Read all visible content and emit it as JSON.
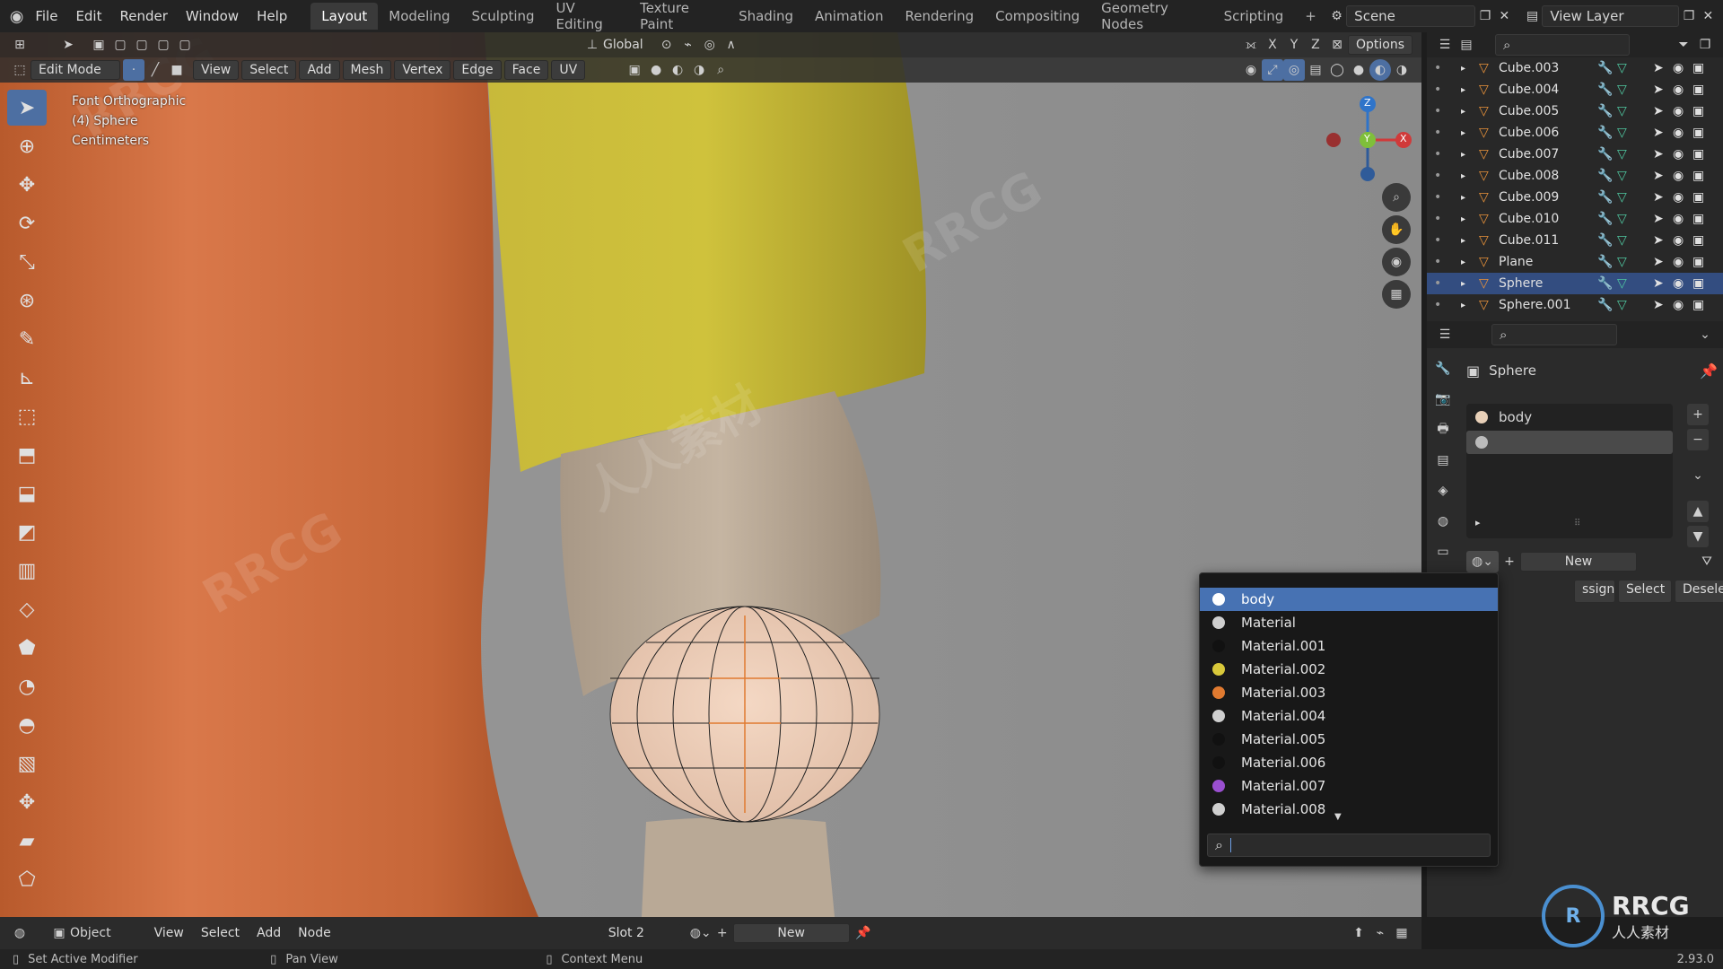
{
  "app": {
    "menus": [
      "File",
      "Edit",
      "Render",
      "Window",
      "Help"
    ],
    "workspace_tabs": [
      "Layout",
      "Modeling",
      "Sculpting",
      "UV Editing",
      "Texture Paint",
      "Shading",
      "Animation",
      "Rendering",
      "Compositing",
      "Geometry Nodes",
      "Scripting"
    ],
    "active_tab": "Layout",
    "scene_label": "Scene",
    "view_layer_label": "View Layer"
  },
  "viewport_header": {
    "transform_orientation": "Global",
    "mode": "Edit Mode",
    "menus": [
      "View",
      "Select",
      "Add",
      "Mesh",
      "Vertex",
      "Edge",
      "Face",
      "UV"
    ],
    "options_label": "Options",
    "axes": [
      "X",
      "Y",
      "Z"
    ]
  },
  "viewport_overlay": {
    "view_name": "Font Orthographic",
    "object_line": "(4) Sphere",
    "units": "Centimeters"
  },
  "gizmo": {
    "x": "X",
    "y": "Y",
    "z": "Z"
  },
  "outliner": {
    "rows": [
      {
        "label": "Cube.003",
        "selected": false
      },
      {
        "label": "Cube.004",
        "selected": false
      },
      {
        "label": "Cube.005",
        "selected": false
      },
      {
        "label": "Cube.006",
        "selected": false
      },
      {
        "label": "Cube.007",
        "selected": false
      },
      {
        "label": "Cube.008",
        "selected": false
      },
      {
        "label": "Cube.009",
        "selected": false
      },
      {
        "label": "Cube.010",
        "selected": false
      },
      {
        "label": "Cube.011",
        "selected": false
      },
      {
        "label": "Plane",
        "selected": false
      },
      {
        "label": "Sphere",
        "selected": true
      },
      {
        "label": "Sphere.001",
        "selected": false
      }
    ]
  },
  "properties": {
    "object_name": "Sphere",
    "slots": [
      {
        "label": "body",
        "color": "#e8d0b8"
      },
      {
        "label": "",
        "color": "#bbbbbb"
      }
    ],
    "new_label": "New",
    "assign_label": "ssign",
    "select_label": "Select",
    "deselect_label": "Deselect"
  },
  "material_dropdown": {
    "items": [
      {
        "label": "body",
        "color": "#ffffff",
        "selected": true
      },
      {
        "label": "Material",
        "color": "#cfcfcf",
        "selected": false
      },
      {
        "label": "Material.001",
        "color": "#111111",
        "selected": false
      },
      {
        "label": "Material.002",
        "color": "#d8c83a",
        "selected": false
      },
      {
        "label": "Material.003",
        "color": "#e07a30",
        "selected": false
      },
      {
        "label": "Material.004",
        "color": "#cfcfcf",
        "selected": false
      },
      {
        "label": "Material.005",
        "color": "#111111",
        "selected": false
      },
      {
        "label": "Material.006",
        "color": "#111111",
        "selected": false
      },
      {
        "label": "Material.007",
        "color": "#9a4fd0",
        "selected": false
      },
      {
        "label": "Material.008",
        "color": "#cfcfcf",
        "selected": false
      }
    ],
    "search_value": ""
  },
  "bottom_header": {
    "editor_type": "Object",
    "menus": [
      "View",
      "Select",
      "Add",
      "Node"
    ],
    "slot_label": "Slot 2",
    "new_label": "New"
  },
  "statusbar": {
    "left": "Set Active Modifier",
    "middle": "Pan View",
    "right": "Context Menu",
    "version": "2.93.0"
  },
  "watermark": {
    "text": "RRCG",
    "cn_text": "人人素材",
    "logo_text": "RRCG",
    "logo_sub": "人人素材"
  }
}
